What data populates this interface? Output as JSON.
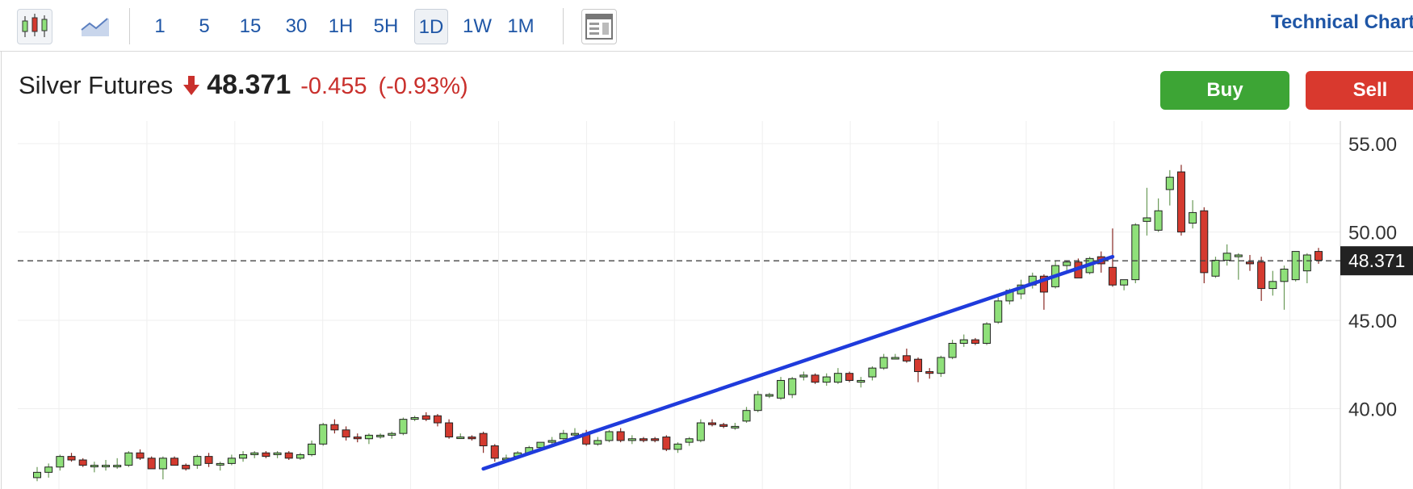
{
  "toolbar": {
    "candles_icon": "candlestick-icon",
    "area_icon": "area-chart-icon",
    "layout_icon": "layout-icon",
    "timeframes": [
      "1",
      "5",
      "15",
      "30",
      "1H",
      "5H",
      "1D",
      "1W",
      "1M"
    ],
    "active_timeframe": "1D",
    "technical_link": "Technical Chart"
  },
  "quote": {
    "name": "Silver Futures",
    "direction_icon": "down-arrow-icon",
    "price": "48.371",
    "change": "-0.455",
    "change_pct": "(-0.93%)",
    "down_color": "#c9302c"
  },
  "actions": {
    "buy_label": "Buy",
    "sell_label": "Sell",
    "buy_color": "#3da535",
    "sell_color": "#d9392e"
  },
  "chart_data": {
    "type": "candlestick",
    "title": "",
    "xlabel": "",
    "ylabel": "",
    "y_ticks": [
      "55.00",
      "50.00",
      "45.00",
      "40.00"
    ],
    "ylim": [
      36.4,
      55.6
    ],
    "last_price": 48.371,
    "last_price_label": "48.371",
    "up_color": "#8fe07a",
    "down_color": "#d43a2f",
    "trendline_color": "#1f3bdc",
    "trendline": {
      "start": [
        39,
        36.6
      ],
      "end": [
        94,
        48.6
      ]
    },
    "candles": [
      [
        36.1,
        36.7,
        35.9,
        36.4
      ],
      [
        36.4,
        36.9,
        36.1,
        36.7
      ],
      [
        36.7,
        37.4,
        36.5,
        37.3
      ],
      [
        37.3,
        37.5,
        37.0,
        37.1
      ],
      [
        37.1,
        37.2,
        36.7,
        36.8
      ],
      [
        36.8,
        37.0,
        36.4,
        36.8
      ],
      [
        36.8,
        37.1,
        36.5,
        36.8
      ],
      [
        36.8,
        37.2,
        36.6,
        36.8
      ],
      [
        36.8,
        37.6,
        36.7,
        37.5
      ],
      [
        37.5,
        37.7,
        37.1,
        37.2
      ],
      [
        37.2,
        37.3,
        36.6,
        36.6
      ],
      [
        36.6,
        37.3,
        36.0,
        37.2
      ],
      [
        37.2,
        37.3,
        36.8,
        36.8
      ],
      [
        36.8,
        36.9,
        36.5,
        36.6
      ],
      [
        36.8,
        37.4,
        36.6,
        37.3
      ],
      [
        37.3,
        37.5,
        36.7,
        36.9
      ],
      [
        36.9,
        37.0,
        36.5,
        36.9
      ],
      [
        36.9,
        37.4,
        36.8,
        37.2
      ],
      [
        37.2,
        37.6,
        37.0,
        37.4
      ],
      [
        37.4,
        37.6,
        37.2,
        37.5
      ],
      [
        37.5,
        37.6,
        37.2,
        37.3
      ],
      [
        37.4,
        37.6,
        37.2,
        37.5
      ],
      [
        37.5,
        37.6,
        37.1,
        37.2
      ],
      [
        37.2,
        37.5,
        37.1,
        37.4
      ],
      [
        37.4,
        38.2,
        37.3,
        38.0
      ],
      [
        38.0,
        39.2,
        37.9,
        39.1
      ],
      [
        39.1,
        39.4,
        38.6,
        38.8
      ],
      [
        38.8,
        39.0,
        38.2,
        38.4
      ],
      [
        38.4,
        38.6,
        38.1,
        38.3
      ],
      [
        38.3,
        38.6,
        38.0,
        38.5
      ],
      [
        38.5,
        38.6,
        38.3,
        38.5
      ],
      [
        38.5,
        38.7,
        38.3,
        38.6
      ],
      [
        38.6,
        39.5,
        38.5,
        39.4
      ],
      [
        39.4,
        39.6,
        39.3,
        39.5
      ],
      [
        39.6,
        39.8,
        39.3,
        39.4
      ],
      [
        39.6,
        39.7,
        39.0,
        39.2
      ],
      [
        39.2,
        39.4,
        38.3,
        38.4
      ],
      [
        38.4,
        38.6,
        38.3,
        38.4
      ],
      [
        38.4,
        38.5,
        38.2,
        38.3
      ],
      [
        38.6,
        38.7,
        37.5,
        37.9
      ],
      [
        37.9,
        38.0,
        37.0,
        37.2
      ],
      [
        37.2,
        37.4,
        37.0,
        37.2
      ],
      [
        37.3,
        37.6,
        37.2,
        37.5
      ],
      [
        37.5,
        37.9,
        37.4,
        37.8
      ],
      [
        37.8,
        38.1,
        37.7,
        38.1
      ],
      [
        38.1,
        38.4,
        37.9,
        38.2
      ],
      [
        38.3,
        38.8,
        38.1,
        38.6
      ],
      [
        38.6,
        38.9,
        38.4,
        38.6
      ],
      [
        38.6,
        38.8,
        37.9,
        38.0
      ],
      [
        38.0,
        38.4,
        37.9,
        38.2
      ],
      [
        38.2,
        38.8,
        38.1,
        38.7
      ],
      [
        38.7,
        38.9,
        38.1,
        38.2
      ],
      [
        38.2,
        38.5,
        38.0,
        38.3
      ],
      [
        38.3,
        38.4,
        38.1,
        38.2
      ],
      [
        38.3,
        38.4,
        38.1,
        38.2
      ],
      [
        38.4,
        38.5,
        37.6,
        37.7
      ],
      [
        37.7,
        38.1,
        37.5,
        38.0
      ],
      [
        38.1,
        38.4,
        37.9,
        38.3
      ],
      [
        38.2,
        39.4,
        38.1,
        39.2
      ],
      [
        39.2,
        39.4,
        39.0,
        39.1
      ],
      [
        39.1,
        39.2,
        38.9,
        39.0
      ],
      [
        39.0,
        39.2,
        38.8,
        39.0
      ],
      [
        39.3,
        40.1,
        39.2,
        39.9
      ],
      [
        39.9,
        41.0,
        39.8,
        40.8
      ],
      [
        40.8,
        40.9,
        40.6,
        40.8
      ],
      [
        40.6,
        41.8,
        40.5,
        41.6
      ],
      [
        40.8,
        41.8,
        40.6,
        41.7
      ],
      [
        41.8,
        42.1,
        41.6,
        41.9
      ],
      [
        41.9,
        42.0,
        41.4,
        41.5
      ],
      [
        41.5,
        42.0,
        41.3,
        41.8
      ],
      [
        41.5,
        42.3,
        41.4,
        42.0
      ],
      [
        42.0,
        42.1,
        41.5,
        41.6
      ],
      [
        41.5,
        41.8,
        41.2,
        41.6
      ],
      [
        41.8,
        42.4,
        41.6,
        42.3
      ],
      [
        42.3,
        43.1,
        42.2,
        42.9
      ],
      [
        42.9,
        43.1,
        42.8,
        42.9
      ],
      [
        43.0,
        43.4,
        42.6,
        42.7
      ],
      [
        42.8,
        42.9,
        41.5,
        42.1
      ],
      [
        42.1,
        42.3,
        41.7,
        42.0
      ],
      [
        42.0,
        43.0,
        41.8,
        42.9
      ],
      [
        42.9,
        43.9,
        42.8,
        43.7
      ],
      [
        43.7,
        44.2,
        43.5,
        43.9
      ],
      [
        43.9,
        44.0,
        43.6,
        43.7
      ],
      [
        43.7,
        44.9,
        43.6,
        44.8
      ],
      [
        44.9,
        46.3,
        44.8,
        46.1
      ],
      [
        46.1,
        46.8,
        45.9,
        46.7
      ],
      [
        46.5,
        47.3,
        46.2,
        47.0
      ],
      [
        47.0,
        47.7,
        46.8,
        47.5
      ],
      [
        47.5,
        47.6,
        45.6,
        46.6
      ],
      [
        46.9,
        48.4,
        46.8,
        48.1
      ],
      [
        48.1,
        48.4,
        47.8,
        48.3
      ],
      [
        48.3,
        48.5,
        47.6,
        47.4
      ],
      [
        47.7,
        48.6,
        47.6,
        48.5
      ],
      [
        48.6,
        48.9,
        47.7,
        48.2
      ],
      [
        48.0,
        50.2,
        46.9,
        47.0
      ],
      [
        47.0,
        47.3,
        46.7,
        47.3
      ],
      [
        47.3,
        50.5,
        47.1,
        50.4
      ],
      [
        50.6,
        52.5,
        49.8,
        50.8
      ],
      [
        50.1,
        51.9,
        50.0,
        51.2
      ],
      [
        52.4,
        53.5,
        51.5,
        53.1
      ],
      [
        53.4,
        53.8,
        49.8,
        50.0
      ],
      [
        50.5,
        51.8,
        50.2,
        51.1
      ],
      [
        51.2,
        51.4,
        47.1,
        47.7
      ],
      [
        47.5,
        48.6,
        47.4,
        48.4
      ],
      [
        48.4,
        49.3,
        48.1,
        48.8
      ],
      [
        48.6,
        48.8,
        47.3,
        48.7
      ],
      [
        48.3,
        48.7,
        47.8,
        48.2
      ],
      [
        48.3,
        48.6,
        46.1,
        46.8
      ],
      [
        46.8,
        47.8,
        46.4,
        47.2
      ],
      [
        47.2,
        48.1,
        45.6,
        47.9
      ],
      [
        47.3,
        48.6,
        47.2,
        48.9
      ],
      [
        47.8,
        48.8,
        47.1,
        48.7
      ],
      [
        48.9,
        49.1,
        48.2,
        48.4
      ]
    ]
  }
}
